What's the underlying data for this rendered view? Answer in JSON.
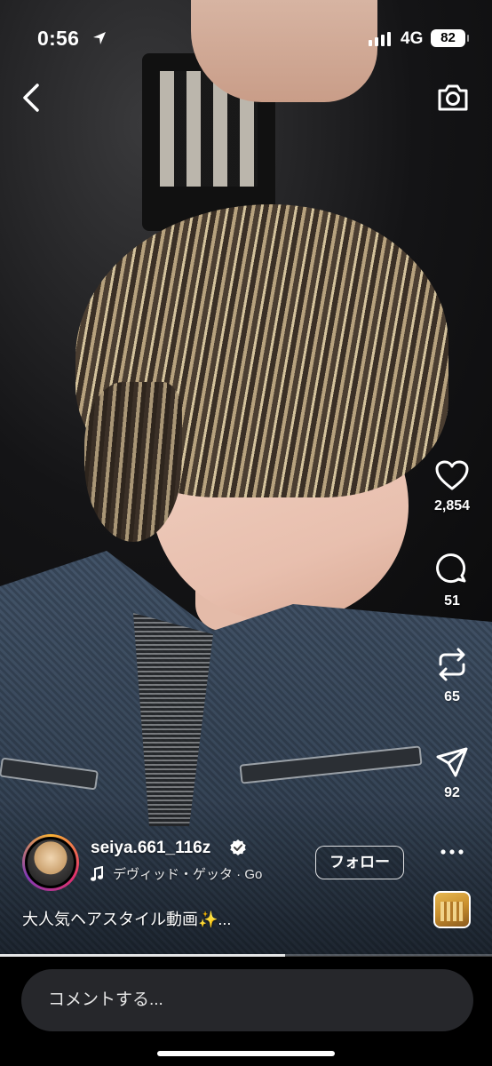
{
  "status_bar": {
    "time": "0:56",
    "network": "4G",
    "battery": "82"
  },
  "rail": {
    "likes": "2,854",
    "comments": "51",
    "reposts": "65",
    "shares": "92"
  },
  "author": {
    "username": "seiya.661_116z",
    "audio": "デヴィッド・ゲッタ · Go",
    "follow_label": "フォロー"
  },
  "caption": "大人気ヘアスタイル動画✨...",
  "comment_placeholder": "コメントする...",
  "playback": {
    "progress": 0.58
  },
  "colors": {
    "background": "#000000",
    "input_bg": "#26272b"
  },
  "icons": {
    "back": "chevron-left-icon",
    "camera": "camera-icon",
    "like": "heart-icon",
    "comment": "comment-bubble-icon",
    "repost": "repost-icon",
    "share": "send-icon",
    "more": "more-dots-icon",
    "music": "music-note-icon",
    "verified": "verified-badge-icon"
  }
}
